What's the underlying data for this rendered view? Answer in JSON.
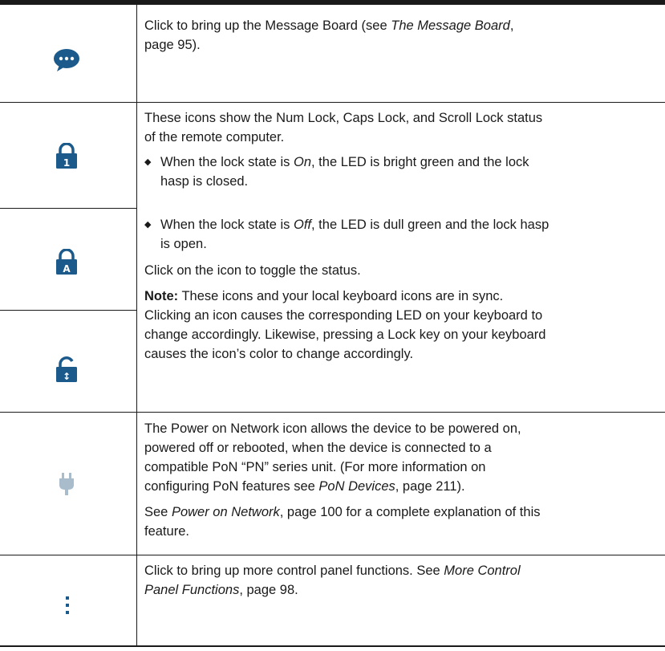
{
  "rows": {
    "message_board": {
      "icon": "speech-bubble-icon",
      "text_a": "Click to bring up the Message Board (see ",
      "ref": "The Message Board",
      "text_b": ",",
      "line2": "page 95)."
    },
    "lock": {
      "icons": [
        "num-lock-icon",
        "caps-lock-icon",
        "scroll-lock-icon"
      ],
      "icon_glyphs": [
        "1",
        "A",
        "↕"
      ],
      "intro_1": "These icons show the Num Lock, Caps Lock, and Scroll Lock status",
      "intro_2": "of the remote computer.",
      "bullet_on_a": "When the lock state is ",
      "bullet_on_state": "On",
      "bullet_on_b": ", the LED is bright green and the lock",
      "bullet_on_2": "hasp is closed.",
      "bullet_off_a": "When the lock state is ",
      "bullet_off_state": "Off",
      "bullet_off_b": ", the LED is dull green and the lock hasp",
      "bullet_off_2": "is open.",
      "toggle": "Click on the icon to toggle the status.",
      "note_label": "Note:",
      "note_1": " These icons and your local keyboard icons are in sync.",
      "note_2": "Clicking an icon causes the corresponding LED on your keyboard to",
      "note_3": "change accordingly. Likewise, pressing a Lock key on your keyboard",
      "note_4": "causes the icon’s color to change accordingly."
    },
    "power": {
      "icon": "power-plug-icon",
      "line1": "The Power on Network icon allows the device to be powered on,",
      "line2": "powered off or rebooted, when the device is connected to a",
      "line3": "compatible PoN “PN” series unit. (For more information on",
      "line4_a": "configuring PoN features see ",
      "line4_ref": "PoN Devices",
      "line4_b": ", page 211).",
      "see_a": "See ",
      "see_ref": "Power on Network",
      "see_b": ", page 100 for a complete explanation of this",
      "see_2": "feature."
    },
    "more": {
      "icon": "vertical-ellipsis-icon",
      "line1_a": "Click to bring up more control panel functions. See ",
      "line1_ref": "More Control",
      "line2_ref": "Panel Functions",
      "line2_b": ", page 98."
    }
  },
  "colors": {
    "icon_blue": "#1b5a8a",
    "plug_gray": "#a9bccc",
    "rule": "#1a1a1a"
  },
  "bullet_glyph": "◆"
}
